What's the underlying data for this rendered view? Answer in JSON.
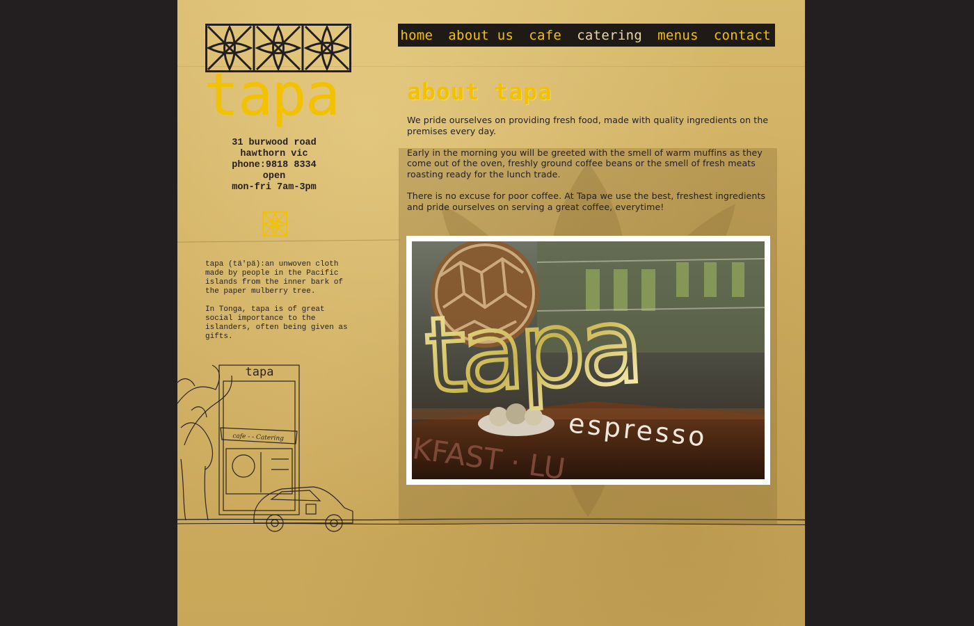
{
  "logo": {
    "word": "tapa"
  },
  "nav": {
    "items": [
      {
        "label": "home"
      },
      {
        "label": "about us"
      },
      {
        "label": "cafe"
      },
      {
        "label": "catering"
      },
      {
        "label": "menus"
      },
      {
        "label": "contact"
      }
    ]
  },
  "contact": {
    "address": "31 burwood road",
    "suburb": "hawthorn vic",
    "phone": "phone:9818 8334",
    "open_label": "open",
    "hours": "mon-fri 7am-3pm"
  },
  "definition": {
    "p1": "tapa (tä'pä):an unwoven cloth made by people in the Pacific islands from the inner bark of the paper mulberry tree.",
    "p2": "In Tonga, tapa is of great social importance to the islanders, often being given as gifts."
  },
  "sketch": {
    "sign": "tapa",
    "awning": "cafe - - Catering"
  },
  "main": {
    "heading": "about tapa",
    "paragraphs": [
      "We pride ourselves on providing fresh food, made with quality ingredients on the premises every day.",
      "Early in the morning you will be greeted with the smell of warm muffins as they come out of the oven, freshly ground coffee beans or the smell of fresh meats roasting ready for the lunch trade.",
      "There is no excuse for poor coffee.  At Tapa we use the best, freshest ingredients and pride ourselves on serving a great coffee, everytime!"
    ]
  },
  "photo": {
    "sign_word": "tapa",
    "sign_sub": "espresso",
    "window_text": "KFAST · LU"
  },
  "colors": {
    "background": "#231f20",
    "paper": "#cfae61",
    "accent_yellow": "#f2c200",
    "nav_bg": "#1f1a16",
    "text": "#231f20"
  }
}
